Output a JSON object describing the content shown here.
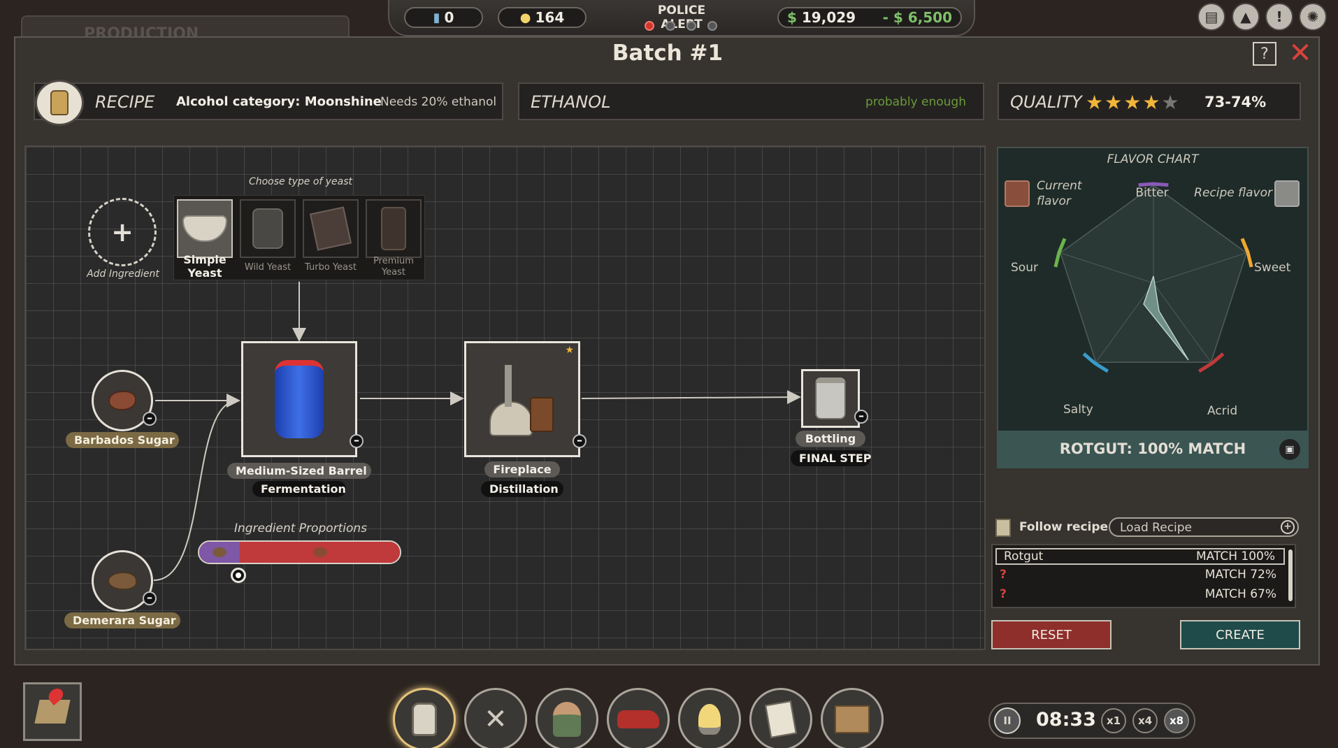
{
  "hud": {
    "jars": "0",
    "ideas": "164",
    "police_title": "POLICE ALERT",
    "money": "19,029",
    "expense": "- $ 6,500",
    "currency_symbol": "$",
    "icons": [
      "book-icon",
      "stats-icon",
      "alert-icon",
      "settings-icon"
    ]
  },
  "background_tab": "PRODUCTION",
  "title": "Batch #1",
  "help_label": "?",
  "close_label": "✕",
  "recipe": {
    "label": "RECIPE",
    "category": "Alcohol category: Moonshine",
    "needs": "Needs 20% ethanol"
  },
  "ethanol": {
    "label": "ETHANOL",
    "status": "probably enough",
    "status_color": "#6a9a3a"
  },
  "quality": {
    "label": "QUALITY",
    "stars": 4,
    "max_stars": 5,
    "range": "73-74%"
  },
  "workflow": {
    "add_ingredient": "Add Ingredient",
    "add_symbol": "+",
    "yeast_prompt": "Choose type of yeast",
    "yeasts": [
      {
        "name": "Simple Yeast",
        "selected": true
      },
      {
        "name": "Wild Yeast",
        "selected": false
      },
      {
        "name": "Turbo Yeast",
        "selected": false
      },
      {
        "name": "Premium Yeast",
        "selected": false
      }
    ],
    "ingredients": [
      {
        "name": "Barbados Sugar",
        "arc_color": "#c0393b"
      },
      {
        "name": "Demerara Sugar",
        "arc_color": "#7e57a6"
      }
    ],
    "steps": [
      {
        "name": "Medium-Sized Barrel",
        "stage": "Fermentation"
      },
      {
        "name": "Fireplace",
        "stage": "Distillation"
      },
      {
        "name": "Bottling",
        "stage": "FINAL STEP"
      }
    ],
    "proportions_label": "Ingredient Proportions",
    "proportion_split": 0.2
  },
  "flavor": {
    "title": "FLAVOR CHART",
    "current_label": "Current flavor",
    "recipe_label": "Recipe flavor",
    "current_color": "#8a4e3c",
    "recipe_color": "#8a8a86",
    "axes": [
      "Bitter",
      "Sweet",
      "Acrid",
      "Salty",
      "Sour"
    ],
    "match": "ROTGUT: 100% MATCH"
  },
  "follow": {
    "label": "Follow recipe:",
    "load": "Load Recipe",
    "rows": [
      {
        "name": "Rotgut",
        "match": "MATCH 100%"
      },
      {
        "name": "?",
        "match": "MATCH 72%"
      },
      {
        "name": "?",
        "match": "MATCH 67%"
      }
    ]
  },
  "buttons": {
    "reset": "RESET",
    "create": "CREATE"
  },
  "dock": [
    "moonshine-jug-icon",
    "tools-icon",
    "worker-icon",
    "car-icon",
    "lightbulb-icon",
    "notes-icon",
    "box-icon"
  ],
  "clock": {
    "time": "08:33",
    "pause": "II",
    "speeds": [
      "x1",
      "x4",
      "x8"
    ]
  }
}
